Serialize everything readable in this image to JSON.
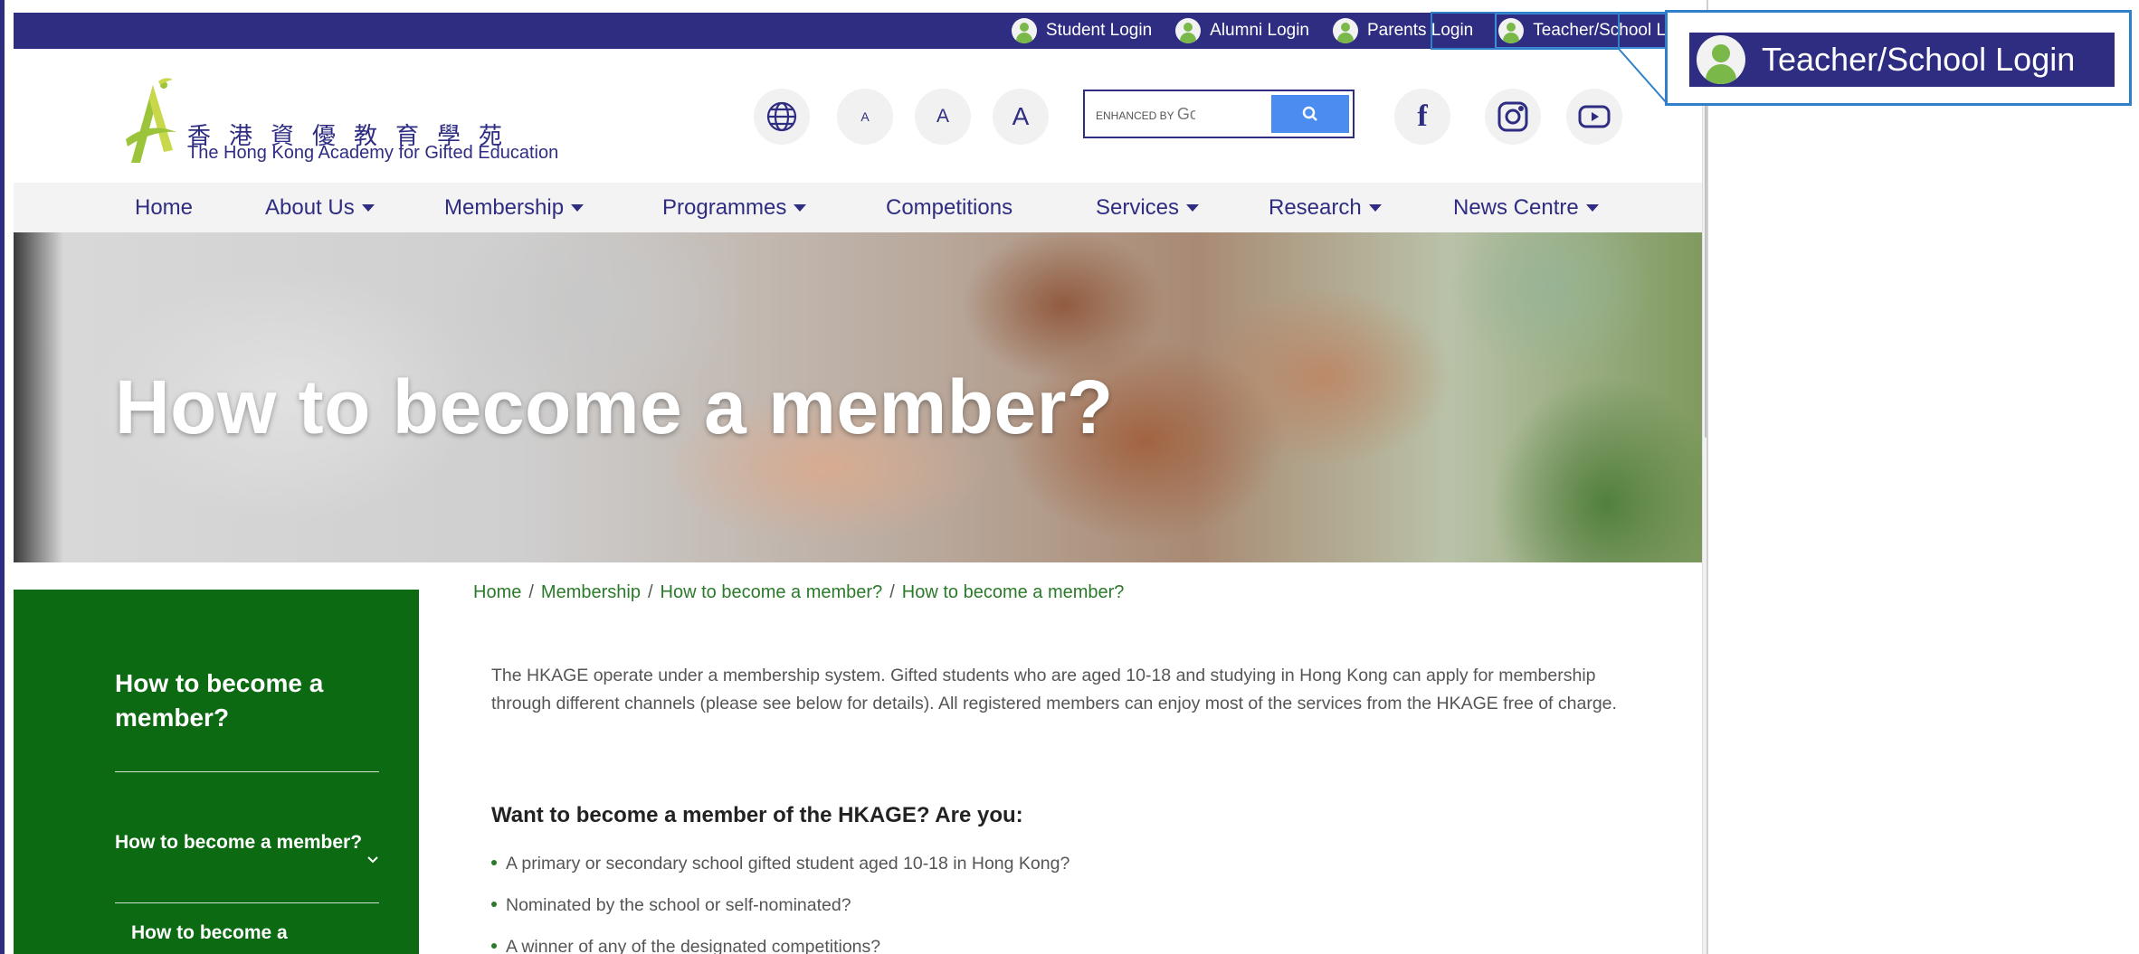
{
  "top_logins": [
    {
      "label": "Student Login"
    },
    {
      "label": "Alumni Login"
    },
    {
      "label": "Parents Login"
    },
    {
      "label": "Teacher/School Login"
    }
  ],
  "logo": {
    "chinese": "香港資優教育學苑",
    "english": "The Hong Kong Academy for Gifted Education"
  },
  "font_sizes": {
    "small": "A",
    "medium": "A",
    "large": "A"
  },
  "search": {
    "label_prefix": "ENHANCED BY",
    "label_brand": "Goog"
  },
  "social": {
    "facebook": "f"
  },
  "nav": [
    {
      "label": "Home",
      "has_dropdown": false
    },
    {
      "label": "About Us",
      "has_dropdown": true
    },
    {
      "label": "Membership",
      "has_dropdown": true
    },
    {
      "label": "Programmes",
      "has_dropdown": true
    },
    {
      "label": "Competitions",
      "has_dropdown": false
    },
    {
      "label": "Services",
      "has_dropdown": true
    },
    {
      "label": "Research",
      "has_dropdown": true
    },
    {
      "label": "News Centre",
      "has_dropdown": true
    }
  ],
  "hero": {
    "title": "How to become a member?"
  },
  "breadcrumb": [
    "Home",
    "Membership",
    "How to become a member?",
    "How to become a member?"
  ],
  "sidebar": {
    "title": "How to become a member?",
    "item": "How to become a member?",
    "sub_item": "How to become a"
  },
  "content": {
    "intro": "The HKAGE operate under a membership system. Gifted students who are aged 10-18 and studying in Hong Kong can apply for membership through different channels (please see below for details). All registered members can enjoy most of the services from the HKAGE free of charge.",
    "question": "Want to become a member of the HKAGE? Are you:",
    "bullets": [
      "A primary or secondary school gifted student aged 10-18 in Hong Kong?",
      "Nominated by the school or self-nominated?",
      "A winner of any of the designated competitions?"
    ]
  },
  "zoom_callout": {
    "label": "Teacher/School Login"
  },
  "colors": {
    "brand_navy": "#2e2d82",
    "brand_green": "#0c6a12",
    "link_green": "#2a7a2a",
    "callout_blue": "#2f80c8"
  }
}
